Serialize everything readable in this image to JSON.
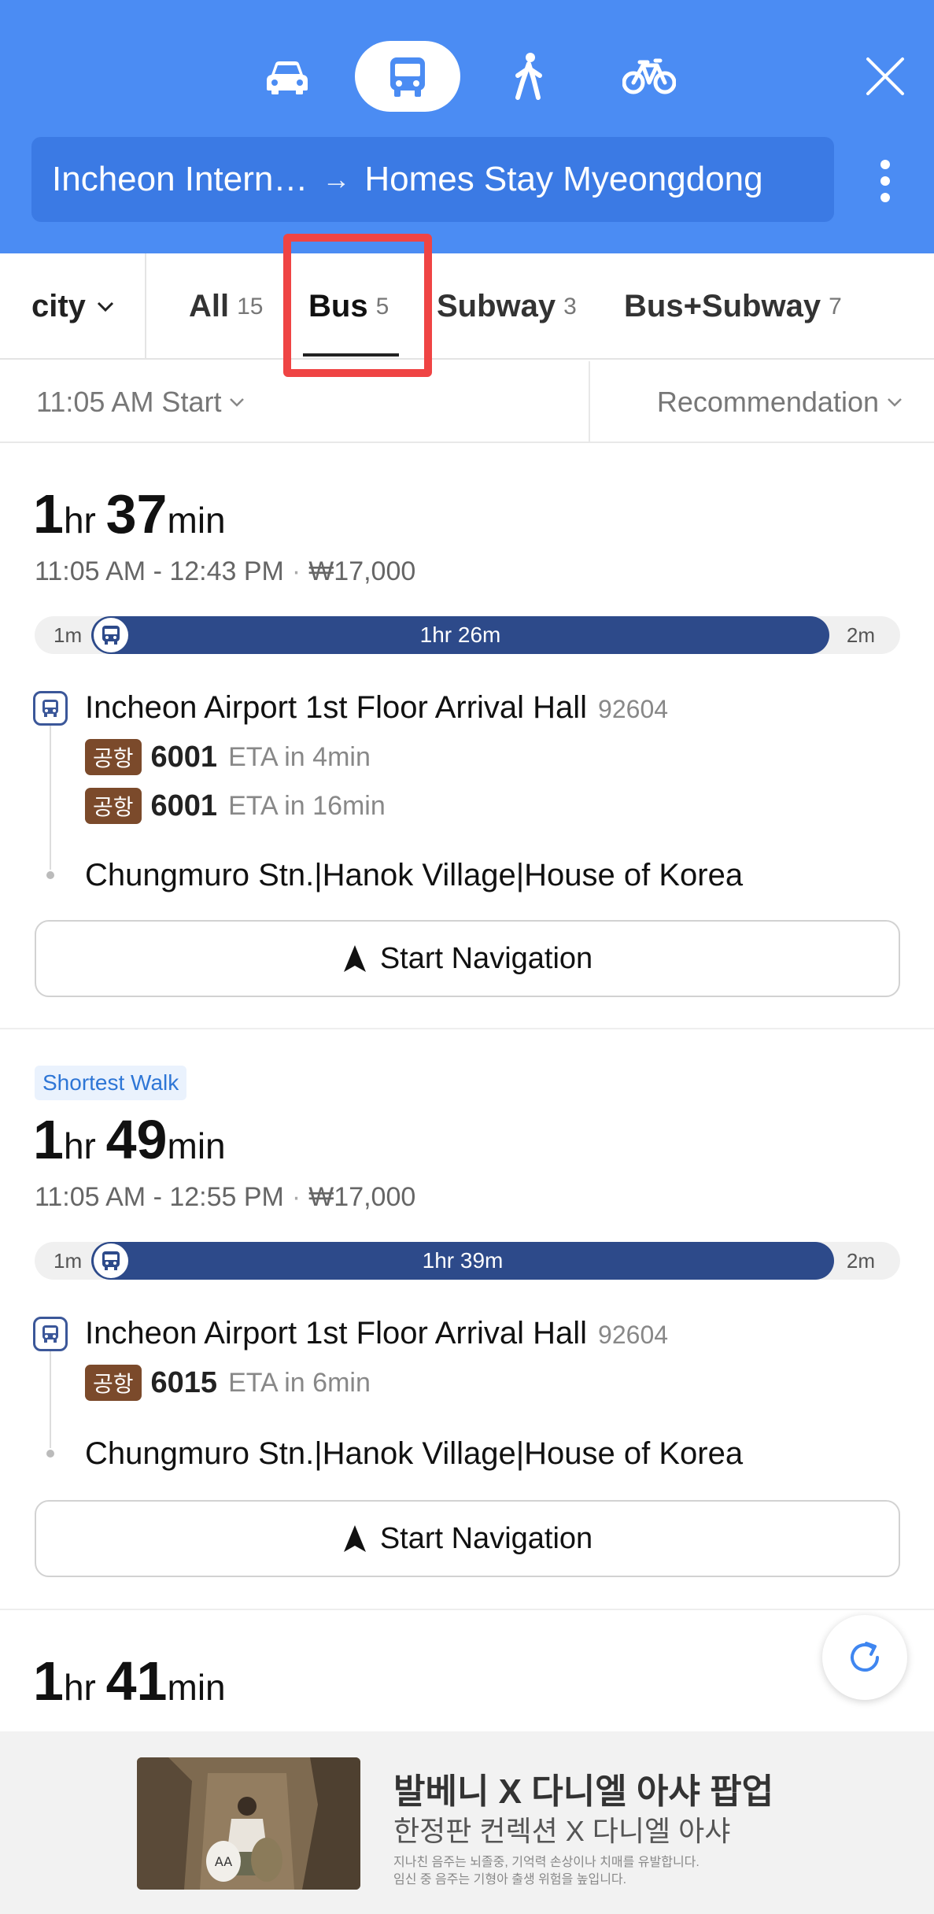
{
  "header": {
    "modes": [
      "car",
      "bus",
      "walk",
      "bike"
    ],
    "selected_mode": "bus",
    "origin": "Incheon Intern…",
    "arrow": "→",
    "destination": "Homes Stay Myeongdong",
    "accent_color": "#4b8cf3"
  },
  "tabs": {
    "city_label": "city",
    "items": [
      {
        "label": "All",
        "count": "15"
      },
      {
        "label": "Bus",
        "count": "5"
      },
      {
        "label": "Subway",
        "count": "3"
      },
      {
        "label": "Bus+Subway",
        "count": "7"
      }
    ],
    "selected": "Bus"
  },
  "filters": {
    "start_label": "11:05 AM Start",
    "sort_label": "Recommendation"
  },
  "routes": [
    {
      "duration_h": "1",
      "h_unit": "hr",
      "duration_m": "37",
      "m_unit": "min",
      "time_range": "11:05 AM - 12:43 PM",
      "fare": "₩17,000",
      "bar": {
        "walk_start": "1m",
        "bus": "1hr 26m",
        "walk_end": "2m",
        "bus_share": 0.93
      },
      "stop": "Incheon Airport 1st Floor Arrival Hall",
      "stop_id": "92604",
      "buses": [
        {
          "badge": "공항",
          "number": "6001",
          "eta": "ETA in 4min"
        },
        {
          "badge": "공항",
          "number": "6001",
          "eta": "ETA in 16min"
        }
      ],
      "destination": "Chungmuro Stn.|Hanok Village|House of Korea",
      "nav_label": "Start Navigation"
    },
    {
      "tag": "Shortest Walk",
      "duration_h": "1",
      "h_unit": "hr",
      "duration_m": "49",
      "m_unit": "min",
      "time_range": "11:05 AM - 12:55 PM",
      "fare": "₩17,000",
      "bar": {
        "walk_start": "1m",
        "bus": "1hr 39m",
        "walk_end": "2m",
        "bus_share": 0.93
      },
      "stop": "Incheon Airport 1st Floor Arrival Hall",
      "stop_id": "92604",
      "buses": [
        {
          "badge": "공항",
          "number": "6015",
          "eta": "ETA in 6min"
        }
      ],
      "destination": "Chungmuro Stn.|Hanok Village|House of Korea",
      "nav_label": "Start Navigation"
    },
    {
      "duration_h": "1",
      "h_unit": "hr",
      "duration_m": "41",
      "m_unit": "min"
    }
  ],
  "ad": {
    "title": "발베니 X 다니엘 아샤 팝업",
    "subtitle": "한정판 컨렉션 X 다니엘 아샤",
    "fine1": "지나친 음주는 뇌졸중, 기억력 손상이나 치매를 유발합니다.",
    "fine2": "임신 중 음주는 기형아 출생 위험을 높입니다."
  }
}
